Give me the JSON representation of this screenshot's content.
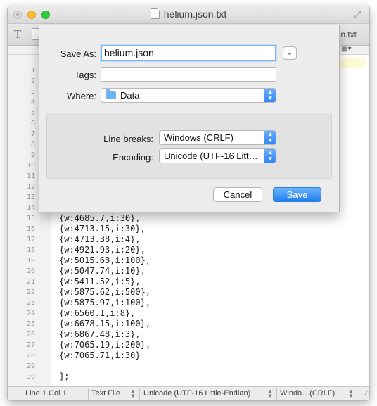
{
  "window": {
    "title": "helium.json.txt",
    "toolbar_filename": "json.txt"
  },
  "editor": {
    "line_numbers": [
      "1",
      "2",
      "3",
      "4",
      "5",
      "6",
      "7",
      "8",
      "9",
      "10",
      "11",
      "12",
      "13",
      "14",
      "15",
      "16",
      "17",
      "18",
      "19",
      "20",
      "21",
      "22",
      "23",
      "24",
      "25",
      "26",
      "27",
      "28",
      "29",
      "30"
    ],
    "visible_lines": [
      {
        "number": "15",
        "text": "{w:4685.7,i:30},"
      },
      {
        "number": "16",
        "text": "{w:4713.15,i:30},"
      },
      {
        "number": "17",
        "text": "{w:4713.38,i:4},"
      },
      {
        "number": "18",
        "text": "{w:4921.93,i:20},"
      },
      {
        "number": "19",
        "text": "{w:5015.68,i:100},"
      },
      {
        "number": "20",
        "text": "{w:5047.74,i:10},"
      },
      {
        "number": "21",
        "text": "{w:5411.52,i:5},"
      },
      {
        "number": "22",
        "text": "{w:5875.62,i:500},"
      },
      {
        "number": "23",
        "text": "{w:5875.97,i:100},"
      },
      {
        "number": "24",
        "text": "{w:6560.1,i:8},"
      },
      {
        "number": "25",
        "text": "{w:6678.15,i:100},"
      },
      {
        "number": "26",
        "text": "{w:6867.48,i:3},"
      },
      {
        "number": "27",
        "text": "{w:7065.19,i:200},"
      },
      {
        "number": "28",
        "text": "{w:7065.71,i:30}"
      },
      {
        "number": "29",
        "text": ""
      },
      {
        "number": "30",
        "text": "];"
      }
    ]
  },
  "save_dialog": {
    "save_as_label": "Save As:",
    "save_as_value": "helium.json",
    "tags_label": "Tags:",
    "tags_value": "",
    "where_label": "Where:",
    "where_value": "Data",
    "line_breaks_label": "Line breaks:",
    "line_breaks_value": "Windows (CRLF)",
    "encoding_label": "Encoding:",
    "encoding_value": "Unicode (UTF-16 Litt…",
    "cancel_label": "Cancel",
    "save_label": "Save"
  },
  "statusbar": {
    "position": "Line 1 Col 1",
    "syntax": "Text File",
    "encoding": "Unicode (UTF-16 Little-Endian)",
    "line_endings": "Windo…(CRLF)"
  },
  "colors": {
    "accent": "#2f84f3",
    "current_line": "#fdfbd6",
    "folder": "#6fb4f0"
  },
  "icons": [
    "close-button-icon",
    "minimize-button-icon",
    "zoom-button-icon",
    "document-icon",
    "fullscreen-icon",
    "text-format-icon",
    "file-icon",
    "folder-icon",
    "expand-chevron-icon",
    "popup-arrows-icon",
    "resize-grip-icon"
  ]
}
